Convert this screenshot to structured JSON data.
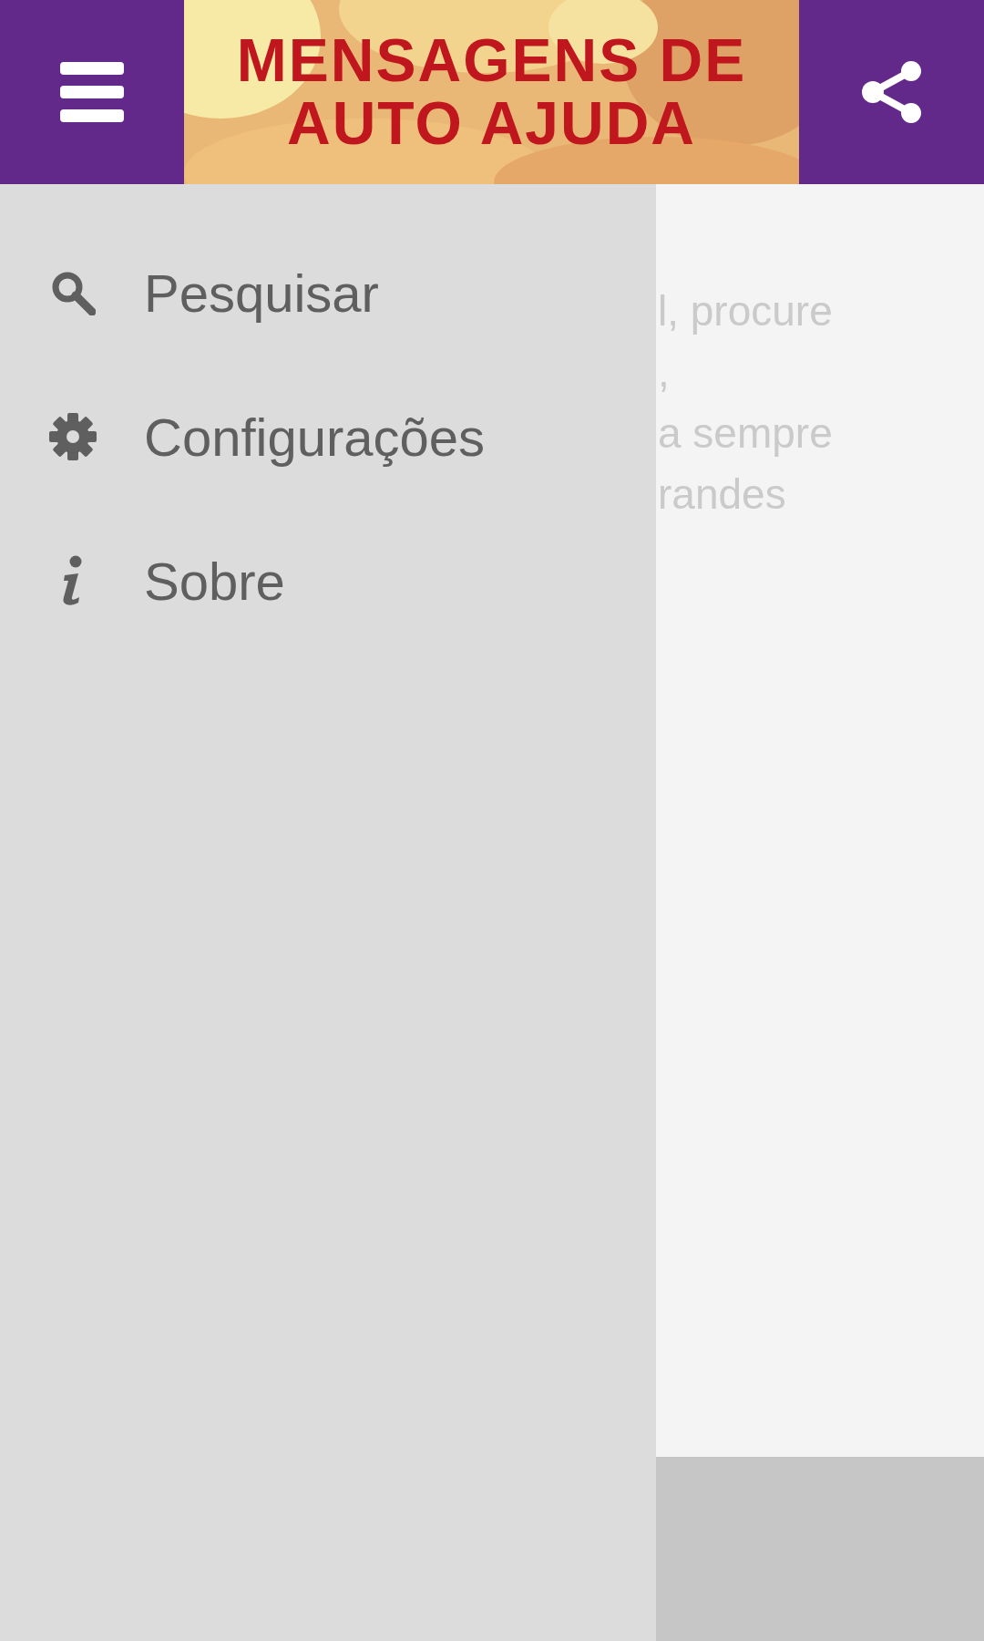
{
  "app_bar": {
    "title_lines": [
      "MENSAGENS DE",
      "AUTO AJUDA"
    ]
  },
  "drawer": {
    "items": [
      {
        "label": "Pesquisar"
      },
      {
        "label": "Configurações"
      },
      {
        "label": "Sobre"
      }
    ]
  },
  "content": {
    "lines": [
      "l, procure",
      ",",
      "a sempre",
      "randes"
    ]
  }
}
